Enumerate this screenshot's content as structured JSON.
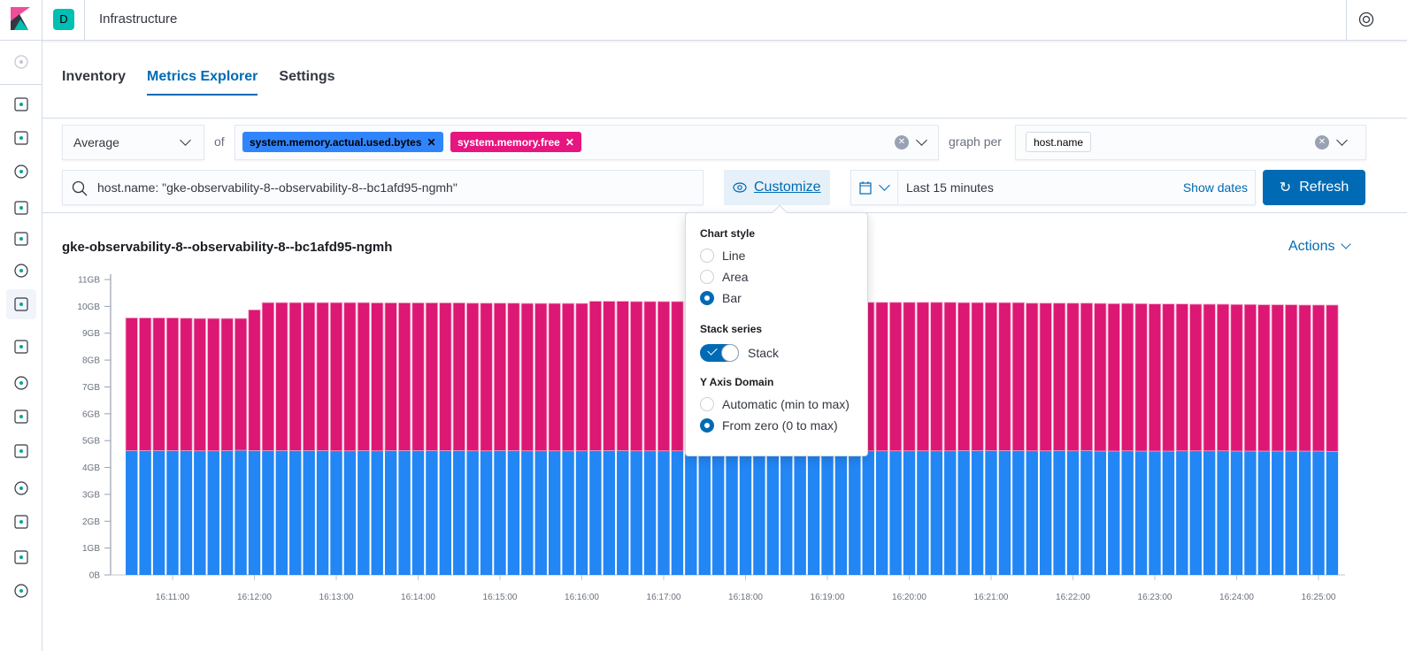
{
  "header": {
    "space_initial": "D",
    "app_title": "Infrastructure"
  },
  "sidebar": {
    "items": [
      "recently-viewed",
      "discover",
      "visualize",
      "dashboard",
      "canvas",
      "maps",
      "machine-learning",
      "infrastructure",
      "logs",
      "apm",
      "uptime",
      "siem",
      "graph",
      "dev-tools",
      "monitoring",
      "management"
    ],
    "active": "infrastructure"
  },
  "tabs": [
    {
      "label": "Inventory"
    },
    {
      "label": "Metrics Explorer",
      "selected": true
    },
    {
      "label": "Settings"
    }
  ],
  "toolbar": {
    "aggregation": "Average",
    "of_label": "of",
    "metrics": [
      {
        "label": "system.memory.actual.used.bytes",
        "color": "#3185fc"
      },
      {
        "label": "system.memory.free",
        "color": "#e7157f"
      }
    ],
    "graph_per_label": "graph per",
    "group_by": "host.name",
    "query": "host.name: \"gke-observability-8--observability-8--bc1afd95-ngmh\"",
    "customize_label": "Customize",
    "time_range": "Last 15 minutes",
    "show_dates": "Show dates",
    "refresh": "Refresh"
  },
  "popover": {
    "chart_style_title": "Chart style",
    "chart_styles": [
      {
        "label": "Line",
        "selected": false
      },
      {
        "label": "Area",
        "selected": false
      },
      {
        "label": "Bar",
        "selected": true
      }
    ],
    "stack_title": "Stack series",
    "stack_label": "Stack",
    "stack_on": true,
    "domain_title": "Y Axis Domain",
    "domains": [
      {
        "label": "Automatic (min to max)",
        "selected": false
      },
      {
        "label": "From zero (0 to max)",
        "selected": true
      }
    ]
  },
  "chart_title": "gke-observability-8--observability-8--bc1afd95-ngmh",
  "actions_label": "Actions",
  "chart_data": {
    "type": "bar",
    "stacked": true,
    "x_start": "16:10:30",
    "interval_seconds": 10,
    "ylim": [
      0,
      11
    ],
    "yticks": [
      "0B",
      "1GB",
      "2GB",
      "3GB",
      "4GB",
      "5GB",
      "6GB",
      "7GB",
      "8GB",
      "9GB",
      "10GB",
      "11GB"
    ],
    "xticks": [
      "16:11:00",
      "16:12:00",
      "16:13:00",
      "16:14:00",
      "16:15:00",
      "16:16:00",
      "16:17:00",
      "16:18:00",
      "16:19:00",
      "16:20:00",
      "16:21:00",
      "16:22:00",
      "16:23:00",
      "16:24:00",
      "16:25:00"
    ],
    "series": [
      {
        "name": "system.memory.actual.used.bytes",
        "color": "#2286f4",
        "values": [
          4.63,
          4.63,
          4.63,
          4.63,
          4.63,
          4.62,
          4.62,
          4.63,
          4.64,
          4.63,
          4.63,
          4.63,
          4.63,
          4.63,
          4.63,
          4.62,
          4.62,
          4.63,
          4.62,
          4.63,
          4.63,
          4.63,
          4.63,
          4.63,
          4.63,
          4.62,
          4.62,
          4.63,
          4.63,
          4.62,
          4.62,
          4.62,
          4.62,
          4.62,
          4.63,
          4.63,
          4.63,
          4.62,
          4.62,
          4.62,
          4.62,
          4.62,
          4.62,
          4.62,
          4.62,
          4.62,
          4.62,
          4.62,
          4.62,
          4.62,
          4.62,
          4.62,
          4.62,
          4.62,
          4.62,
          4.62,
          4.62,
          4.62,
          4.62,
          4.62,
          4.62,
          4.63,
          4.63,
          4.63,
          4.63,
          4.63,
          4.62,
          4.62,
          4.63,
          4.62,
          4.63,
          4.61,
          4.61,
          4.62,
          4.61,
          4.61,
          4.61,
          4.62,
          4.62,
          4.62,
          4.62,
          4.61,
          4.61,
          4.61,
          4.61,
          4.61,
          4.61,
          4.61,
          4.6
        ]
      },
      {
        "name": "system.memory.free",
        "color": "#dc1774",
        "values": [
          4.94,
          4.94,
          4.94,
          4.94,
          4.93,
          4.93,
          4.93,
          4.92,
          4.91,
          5.24,
          5.51,
          5.51,
          5.51,
          5.51,
          5.51,
          5.52,
          5.52,
          5.51,
          5.51,
          5.5,
          5.5,
          5.5,
          5.5,
          5.5,
          5.5,
          5.5,
          5.5,
          5.49,
          5.49,
          5.49,
          5.49,
          5.49,
          5.49,
          5.49,
          5.56,
          5.56,
          5.56,
          5.56,
          5.56,
          5.56,
          5.56,
          5.56,
          5.53,
          5.53,
          5.53,
          5.53,
          5.53,
          5.53,
          5.53,
          5.53,
          5.53,
          5.53,
          5.53,
          5.53,
          5.53,
          5.53,
          5.53,
          5.53,
          5.53,
          5.53,
          5.53,
          5.51,
          5.51,
          5.51,
          5.51,
          5.51,
          5.5,
          5.5,
          5.49,
          5.5,
          5.49,
          5.5,
          5.49,
          5.49,
          5.49,
          5.48,
          5.48,
          5.47,
          5.46,
          5.46,
          5.46,
          5.46,
          5.46,
          5.45,
          5.45,
          5.45,
          5.44,
          5.44,
          5.45
        ]
      }
    ]
  }
}
